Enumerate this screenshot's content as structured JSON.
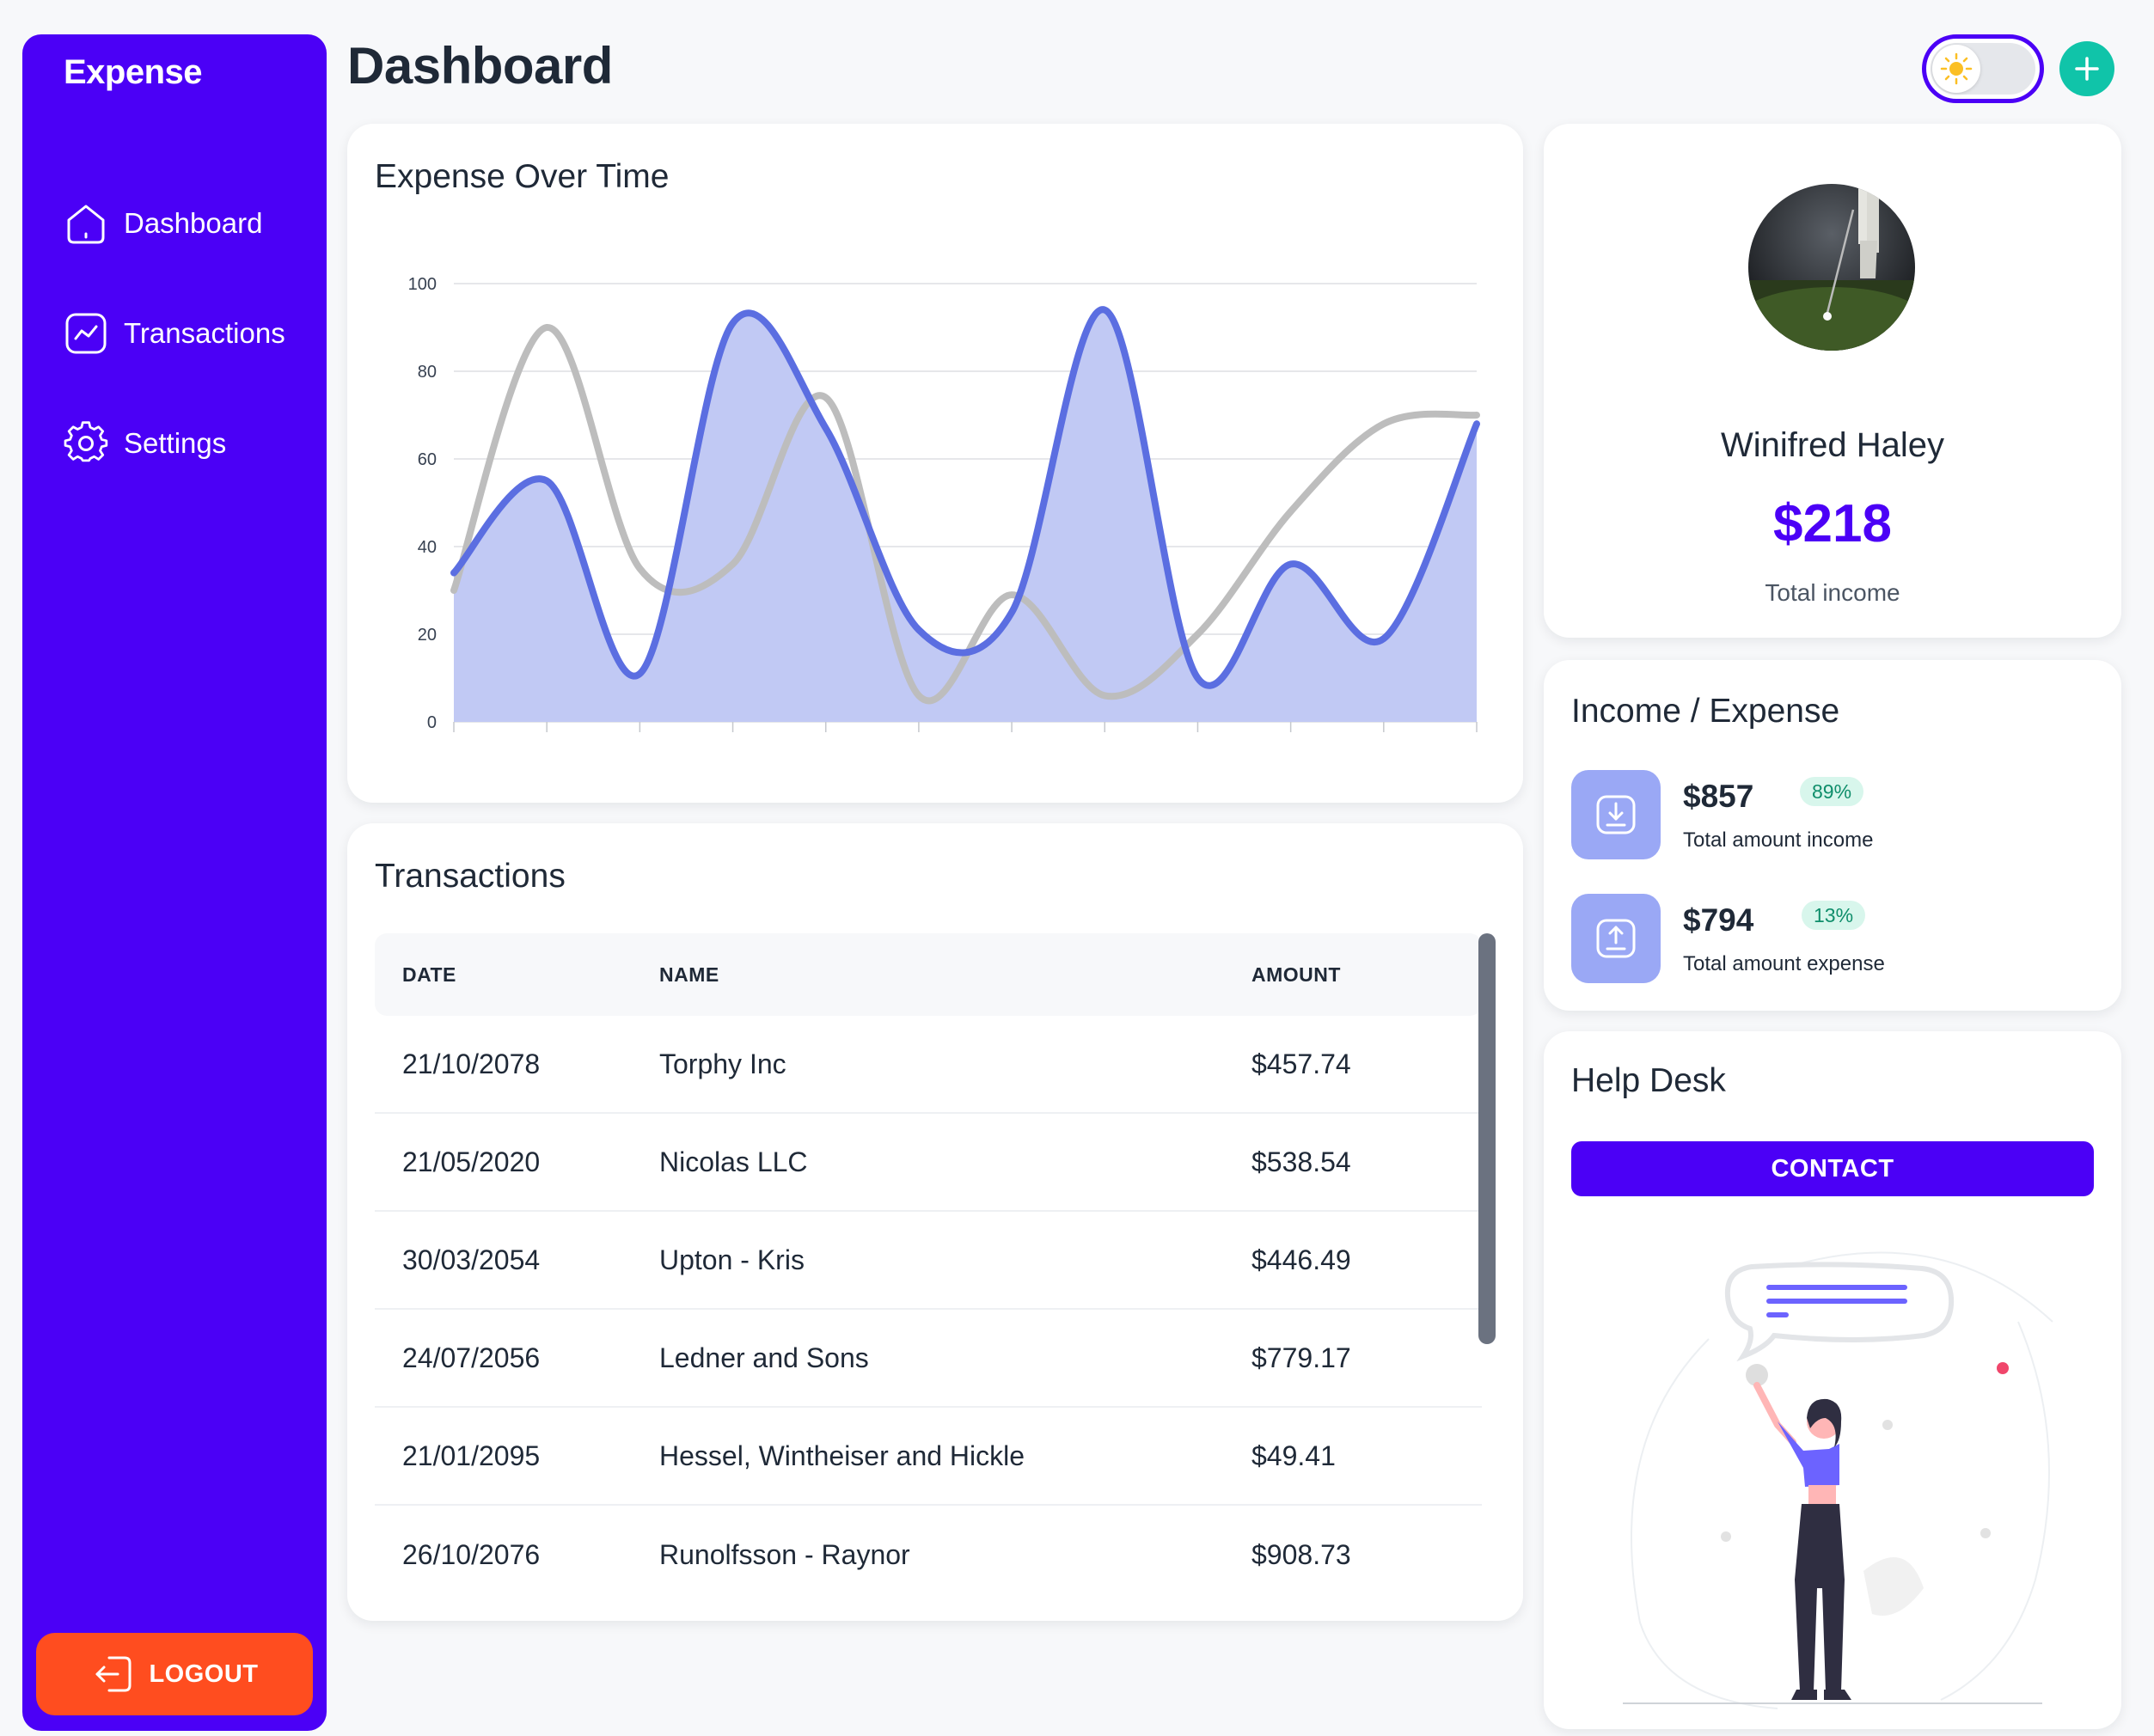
{
  "sidebar": {
    "brand": "Expense",
    "items": [
      {
        "label": "Dashboard",
        "icon": "home-icon"
      },
      {
        "label": "Transactions",
        "icon": "trend-icon"
      },
      {
        "label": "Settings",
        "icon": "gear-icon"
      }
    ],
    "logout_label": "LOGOUT",
    "color": "#4b00f6",
    "logout_color": "#ff4d1f"
  },
  "header": {
    "title": "Dashboard",
    "theme_toggle_icon": "sun-icon",
    "add_icon": "plus-icon",
    "accent_color": "#10c4a9"
  },
  "chart": {
    "title": "Expense Over Time"
  },
  "chart_data": {
    "type": "area",
    "title": "Expense Over Time",
    "xlabel": "",
    "ylabel": "",
    "ylim": [
      0,
      100
    ],
    "yticks": [
      0,
      20,
      40,
      60,
      80,
      100
    ],
    "grid": true,
    "x": [
      0,
      1,
      2,
      3,
      4,
      5,
      6,
      7,
      8,
      9,
      10,
      11
    ],
    "series": [
      {
        "values": [
          34,
          55,
          11,
          91,
          67,
          21,
          25,
          94,
          10,
          36,
          19,
          68
        ],
        "color": "#5b6ee1",
        "fill": "#c1c9f4"
      },
      {
        "values": [
          30,
          90,
          35,
          36,
          74,
          6,
          29,
          6,
          20,
          48,
          68,
          70
        ],
        "color": "#bdbdbd"
      }
    ]
  },
  "transactions": {
    "title": "Transactions",
    "columns": [
      "DATE",
      "NAME",
      "AMOUNT"
    ],
    "rows": [
      {
        "date": "21/10/2078",
        "name": "Torphy Inc",
        "amount": "$457.74"
      },
      {
        "date": "21/05/2020",
        "name": "Nicolas LLC",
        "amount": "$538.54"
      },
      {
        "date": "30/03/2054",
        "name": "Upton - Kris",
        "amount": "$446.49"
      },
      {
        "date": "24/07/2056",
        "name": "Ledner and Sons",
        "amount": "$779.17"
      },
      {
        "date": "21/01/2095",
        "name": "Hessel, Wintheiser and Hickle",
        "amount": "$49.41"
      },
      {
        "date": "26/10/2076",
        "name": "Runolfsson - Raynor",
        "amount": "$908.73"
      }
    ]
  },
  "profile": {
    "name": "Winifred Haley",
    "amount": "$218",
    "label": "Total income"
  },
  "income_expense": {
    "title": "Income / Expense",
    "income": {
      "amount": "$857",
      "badge": "89%",
      "label": "Total amount income",
      "icon": "download-icon"
    },
    "expense": {
      "amount": "$794",
      "badge": "13%",
      "label": "Total amount expense",
      "icon": "upload-icon"
    }
  },
  "help": {
    "title": "Help Desk",
    "contact_label": "CONTACT"
  }
}
